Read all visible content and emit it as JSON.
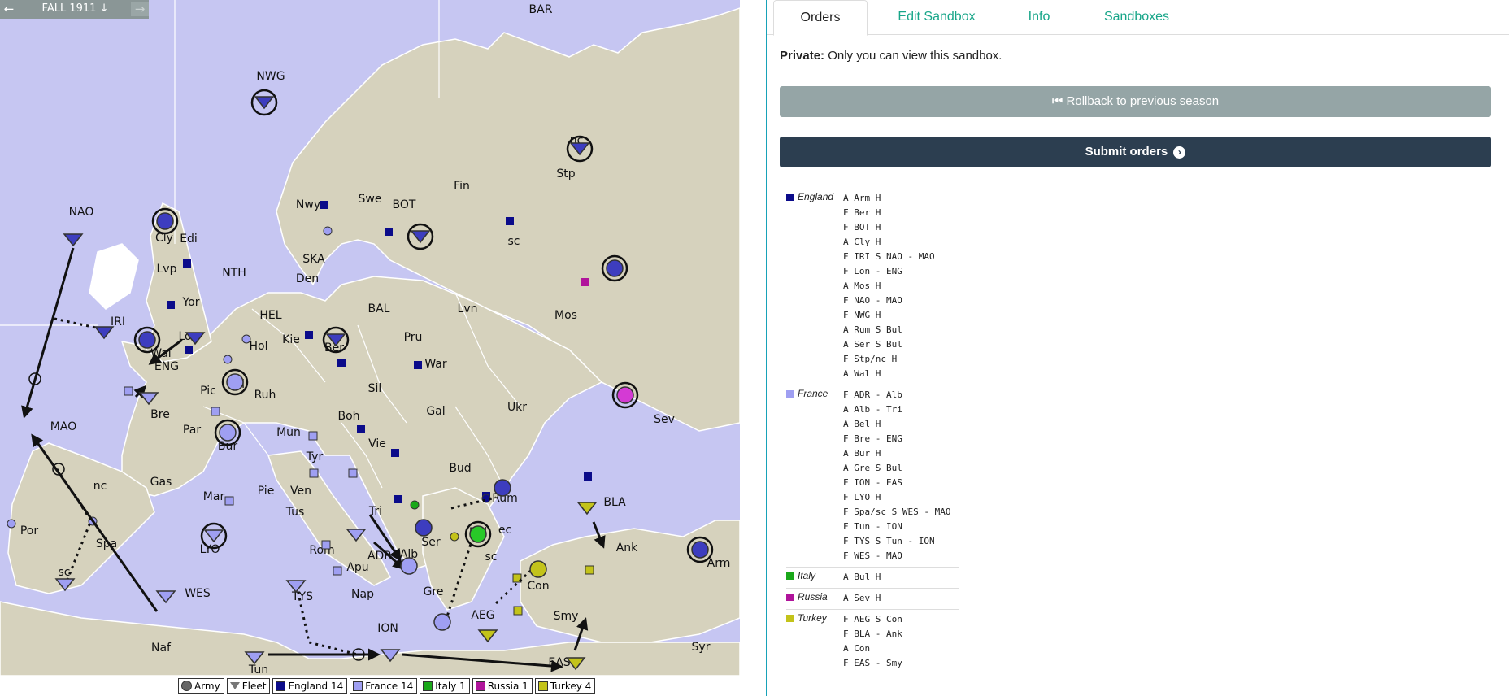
{
  "season": {
    "label": "FALL 1911",
    "down_icon": "arrow-down-icon",
    "prev_icon": "arrow-left-icon",
    "next_icon": "arrow-right-icon"
  },
  "map": {
    "labels": [
      "BAR",
      "NWG",
      "NAO",
      "Cly",
      "Edi",
      "Lvp",
      "NTH",
      "Yor",
      "IRI",
      "Wal",
      "Lon",
      "ENG",
      "Bre",
      "Pic",
      "Bel",
      "Hol",
      "Ruh",
      "Par",
      "Bur",
      "MAO",
      "Gas",
      "nc",
      "Por",
      "Spa",
      "sc",
      "Mar",
      "LYO",
      "WES",
      "Pie",
      "Tus",
      "Rom",
      "Apu",
      "Nap",
      "TYS",
      "ION",
      "Naf",
      "Tun",
      "Nwy",
      "Swe",
      "SKA",
      "Den",
      "HEL",
      "Kie",
      "BAL",
      "Ber",
      "BOT",
      "Fin",
      "sc",
      "Stp",
      "Lvn",
      "Mos",
      "Pru",
      "War",
      "Sil",
      "Mun",
      "Boh",
      "Tyr",
      "Ven",
      "Vie",
      "Gal",
      "Bud",
      "Ukr",
      "Sev",
      "Tri",
      "Ser",
      "Alb",
      "ADR",
      "Gre",
      "Bul",
      "ec",
      "sc",
      "Rum",
      "BLA",
      "Ank",
      "Con",
      "Smy",
      "AEG",
      "Arm",
      "Syr",
      "EAS",
      "nc"
    ]
  },
  "legend": [
    {
      "label": "Army",
      "kind": "army"
    },
    {
      "label": "Fleet",
      "kind": "fleet"
    },
    {
      "label": "England 14",
      "color": "#0b0b8a"
    },
    {
      "label": "France 14",
      "color": "#9f9ff2"
    },
    {
      "label": "Italy 1",
      "color": "#1aa81a"
    },
    {
      "label": "Russia 1",
      "color": "#b0149b"
    },
    {
      "label": "Turkey 4",
      "color": "#c3c31a"
    }
  ],
  "tabs": [
    {
      "label": "Orders",
      "active": true
    },
    {
      "label": "Edit Sandbox"
    },
    {
      "label": "Info"
    },
    {
      "label": "Sandboxes"
    }
  ],
  "private_note": {
    "bold": "Private:",
    "text": " Only you can view this sandbox."
  },
  "buttons": {
    "rollback": "Rollback to previous season",
    "rollback_icon": "skip-back-icon",
    "submit": "Submit orders",
    "submit_icon": "chevron-circle-right-icon"
  },
  "nations": [
    {
      "name": "England",
      "color": "#0b0b8a",
      "orders": [
        "A Arm H",
        "F Ber H",
        "F BOT H",
        "A Cly H",
        "F IRI S NAO - MAO",
        "F Lon - ENG",
        "A Mos H",
        "F NAO - MAO",
        "F NWG H",
        "A Rum S Bul",
        "A Ser S Bul",
        "F Stp/nc H",
        "A Wal H"
      ]
    },
    {
      "name": "France",
      "color": "#9f9ff2",
      "orders": [
        "F ADR - Alb",
        "A Alb - Tri",
        "A Bel H",
        "F Bre - ENG",
        "A Bur H",
        "A Gre S Bul",
        "F ION - EAS",
        "F LYO H",
        "F Spa/sc S WES - MAO",
        "F Tun - ION",
        "F TYS S Tun - ION",
        "F WES - MAO"
      ]
    },
    {
      "name": "Italy",
      "color": "#1aa81a",
      "orders": [
        "A Bul H"
      ]
    },
    {
      "name": "Russia",
      "color": "#b0149b",
      "orders": [
        "A Sev H"
      ]
    },
    {
      "name": "Turkey",
      "color": "#c3c31a",
      "orders": [
        "F AEG S Con",
        "F BLA - Ank",
        "A Con",
        "F EAS - Smy"
      ]
    }
  ]
}
